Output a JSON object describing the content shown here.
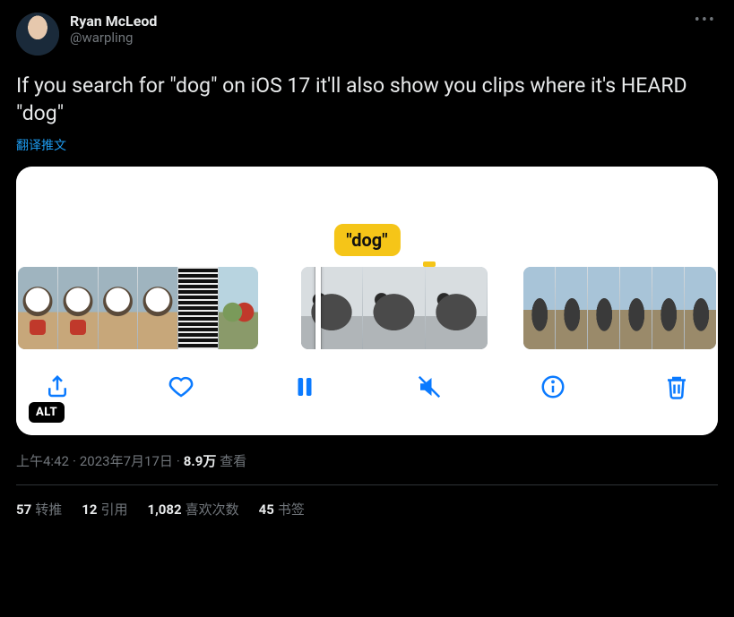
{
  "author": {
    "display_name": "Ryan McLeod",
    "handle": "@warpling"
  },
  "tweet_text": "If you search for \"dog\" on iOS 17 it'll also show you clips where it's HEARD \"dog\"",
  "translate_label": "翻译推文",
  "media": {
    "caption_bubble": "\"dog\"",
    "alt_badge": "ALT",
    "toolbar_icons": [
      "share",
      "like",
      "pause",
      "mute",
      "info",
      "trash"
    ]
  },
  "meta": {
    "time": "上午4:42",
    "date": "2023年7月17日",
    "views_count": "8.9万",
    "views_label": "查看"
  },
  "stats": {
    "retweets_count": "57",
    "retweets_label": "转推",
    "quotes_count": "12",
    "quotes_label": "引用",
    "likes_count": "1,082",
    "likes_label": "喜欢次数",
    "bookmarks_count": "45",
    "bookmarks_label": "书签"
  }
}
